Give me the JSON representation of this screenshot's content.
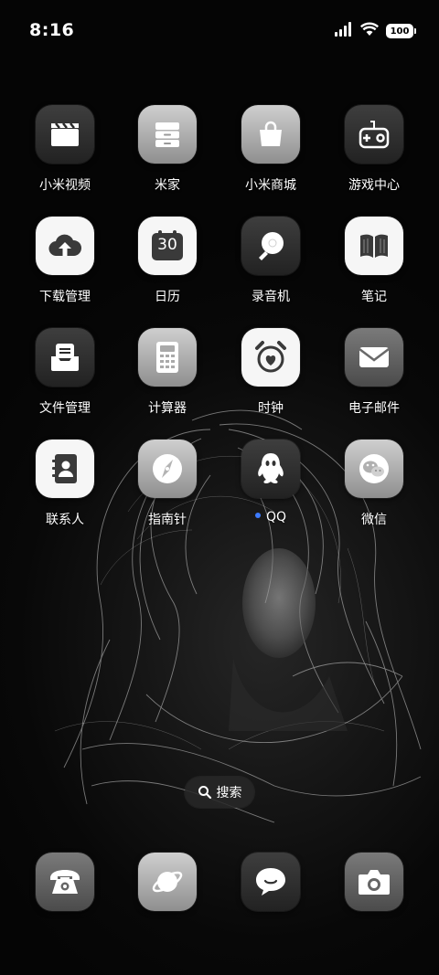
{
  "status_bar": {
    "time": "8:16",
    "battery_level": "100"
  },
  "apps": [
    {
      "id": "xiaomi-video",
      "label": "小米视频",
      "icon": "clapperboard-icon"
    },
    {
      "id": "mijia",
      "label": "米家",
      "icon": "drawer-icon"
    },
    {
      "id": "mi-store",
      "label": "小米商城",
      "icon": "shopping-bag-icon"
    },
    {
      "id": "game-center",
      "label": "游戏中心",
      "icon": "gamepad-icon"
    },
    {
      "id": "downloads",
      "label": "下载管理",
      "icon": "cloud-download-icon"
    },
    {
      "id": "calendar",
      "label": "日历",
      "icon": "calendar-icon",
      "icon_text": "30"
    },
    {
      "id": "recorder",
      "label": "录音机",
      "icon": "microphone-icon"
    },
    {
      "id": "notes",
      "label": "笔记",
      "icon": "book-icon"
    },
    {
      "id": "file-manager",
      "label": "文件管理",
      "icon": "inbox-icon"
    },
    {
      "id": "calculator",
      "label": "计算器",
      "icon": "calculator-icon"
    },
    {
      "id": "clock",
      "label": "时钟",
      "icon": "alarm-clock-icon"
    },
    {
      "id": "email",
      "label": "电子邮件",
      "icon": "envelope-icon"
    },
    {
      "id": "contacts",
      "label": "联系人",
      "icon": "contact-book-icon"
    },
    {
      "id": "compass",
      "label": "指南针",
      "icon": "compass-icon"
    },
    {
      "id": "qq",
      "label": "QQ",
      "icon": "qq-penguin-icon",
      "badge": "new-install-dot"
    },
    {
      "id": "wechat",
      "label": "微信",
      "icon": "wechat-icon"
    }
  ],
  "search": {
    "label": "搜索",
    "icon": "search-icon"
  },
  "dock": [
    {
      "id": "phone",
      "icon": "telephone-icon"
    },
    {
      "id": "browser",
      "icon": "planet-icon"
    },
    {
      "id": "messages",
      "icon": "chat-bubble-icon"
    },
    {
      "id": "camera",
      "icon": "camera-icon"
    }
  ],
  "colors": {
    "background": "#050505",
    "badge_dot": "#3d7bff",
    "label_text": "#ffffff"
  }
}
